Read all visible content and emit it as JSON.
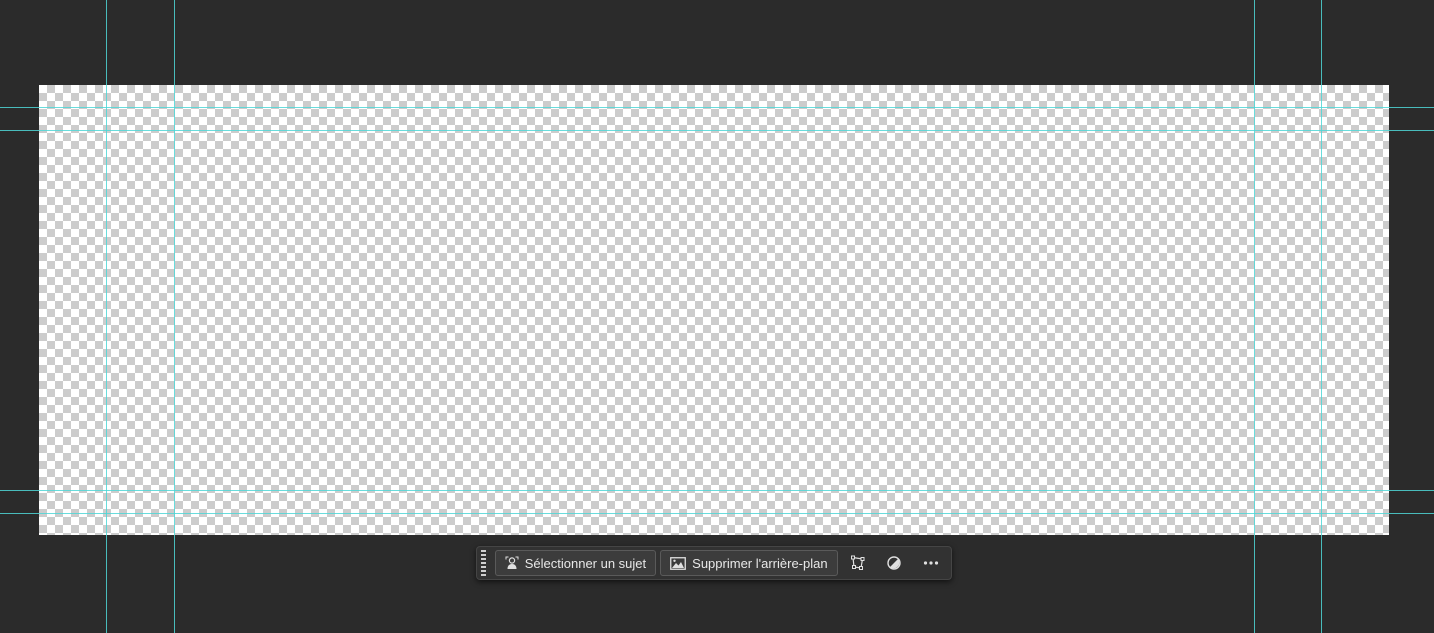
{
  "taskbar": {
    "select_subject_label": "Sélectionner un sujet",
    "remove_background_label": "Supprimer l'arrière-plan",
    "icons": {
      "grip": "drag-grip-icon",
      "select_subject": "person-icon",
      "remove_background": "image-icon",
      "transform": "transform-icon",
      "adjustment": "half-circle-icon",
      "more": "more-dots-icon"
    }
  },
  "colors": {
    "workspace_background": "#2b2b2b",
    "guide": "#4fd6d6",
    "checker_light": "#ffffff",
    "checker_dark": "#cccccc",
    "taskbar_background": "#323232"
  }
}
